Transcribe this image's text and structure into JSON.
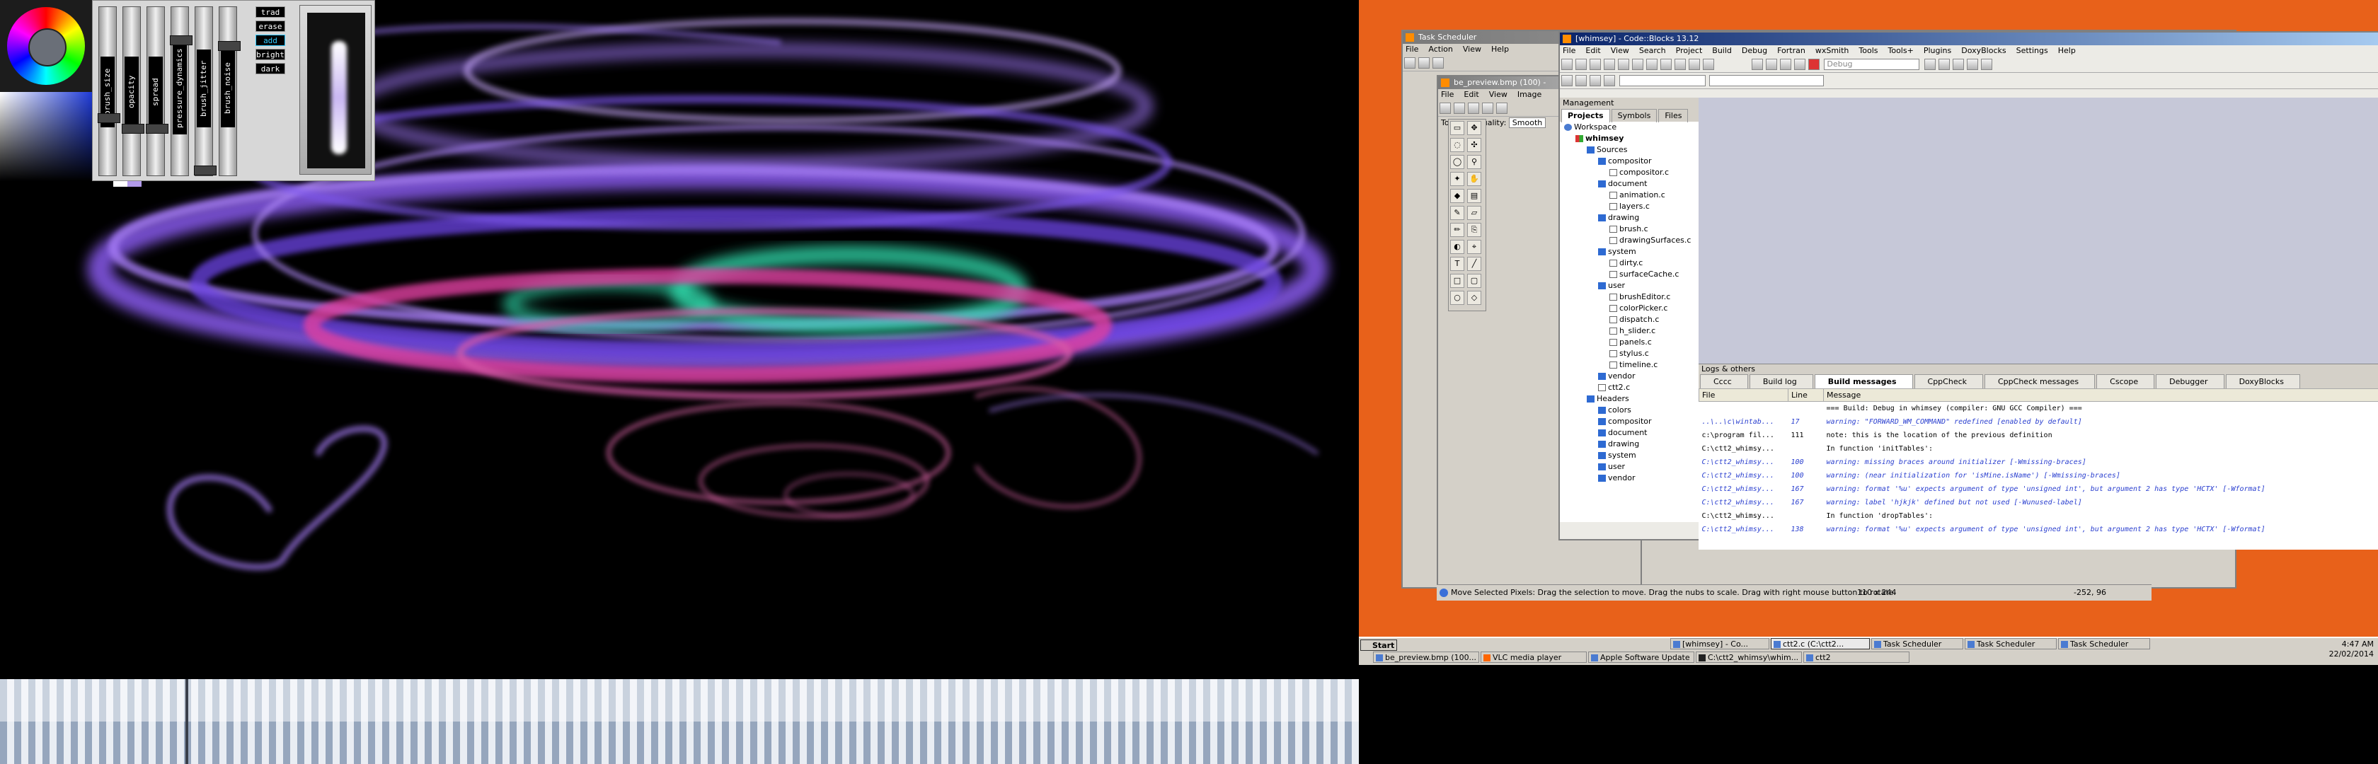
{
  "brush_panel": {
    "sliders": [
      "brush_size",
      "opacity",
      "spread",
      "pressure_dynamics",
      "brush_jitter",
      "brush_noise"
    ],
    "mode_buttons": [
      "trad",
      "erase",
      "add",
      "bright",
      "dark"
    ],
    "active_mode": "add",
    "colors": {
      "accent": "#33ccff",
      "swatch_a": "#ffffff",
      "swatch_b": "#b29bea"
    }
  },
  "colors": {
    "desktop_bg": "#e8611a",
    "stroke_violet": "#8a5cf0",
    "stroke_pink": "#e040a0",
    "stroke_teal": "#30e0b0"
  },
  "task_scheduler": {
    "title": "Task Scheduler",
    "menu": [
      "File",
      "Action",
      "View",
      "Help"
    ]
  },
  "paint": {
    "tab_title": "be_preview.bmp (100) -",
    "menu": [
      "File",
      "Edit",
      "View",
      "Image"
    ],
    "tool_label": "Tool:",
    "quality_label": "Quality:",
    "quality_value": "Smooth",
    "status_text": "Move Selected Pixels: Drag the selection to move. Drag the nubs to scale. Drag with right mouse button to rotate.",
    "selection_size": "110 x 244",
    "cursor_pos": "-252, 96"
  },
  "codeblocks": {
    "title": "[whimsey] - Code::Blocks 13.12",
    "menu": [
      "File",
      "Edit",
      "View",
      "Search",
      "Project",
      "Build",
      "Debug",
      "Fortran",
      "wxSmith",
      "Tools",
      "Tools+",
      "Plugins",
      "DoxyBlocks",
      "Settings",
      "Help"
    ],
    "build_target": "Debug",
    "management": {
      "header": "Management",
      "tabs": [
        "Projects",
        "Symbols",
        "Files"
      ],
      "tree": [
        {
          "depth": 0,
          "type": "ws",
          "label": "Workspace"
        },
        {
          "depth": 1,
          "type": "proj",
          "label": "whimsey"
        },
        {
          "depth": 2,
          "type": "folder",
          "label": "Sources"
        },
        {
          "depth": 3,
          "type": "folder",
          "label": "compositor"
        },
        {
          "depth": 4,
          "type": "file",
          "label": "compositor.c"
        },
        {
          "depth": 3,
          "type": "folder",
          "label": "document"
        },
        {
          "depth": 4,
          "type": "file",
          "label": "animation.c"
        },
        {
          "depth": 4,
          "type": "file",
          "label": "layers.c"
        },
        {
          "depth": 3,
          "type": "folder",
          "label": "drawing"
        },
        {
          "depth": 4,
          "type": "file",
          "label": "brush.c"
        },
        {
          "depth": 4,
          "type": "file",
          "label": "drawingSurfaces.c"
        },
        {
          "depth": 3,
          "type": "folder",
          "label": "system"
        },
        {
          "depth": 4,
          "type": "file",
          "label": "dirty.c"
        },
        {
          "depth": 4,
          "type": "file",
          "label": "surfaceCache.c"
        },
        {
          "depth": 3,
          "type": "folder",
          "label": "user"
        },
        {
          "depth": 4,
          "type": "file",
          "label": "brushEditor.c"
        },
        {
          "depth": 4,
          "type": "file",
          "label": "colorPicker.c"
        },
        {
          "depth": 4,
          "type": "file",
          "label": "dispatch.c"
        },
        {
          "depth": 4,
          "type": "file",
          "label": "h_slider.c"
        },
        {
          "depth": 4,
          "type": "file",
          "label": "panels.c"
        },
        {
          "depth": 4,
          "type": "file",
          "label": "stylus.c"
        },
        {
          "depth": 4,
          "type": "file",
          "label": "timeline.c"
        },
        {
          "depth": 3,
          "type": "folder",
          "label": "vendor"
        },
        {
          "depth": 3,
          "type": "file",
          "label": "ctt2.c"
        },
        {
          "depth": 2,
          "type": "folder",
          "label": "Headers"
        },
        {
          "depth": 3,
          "type": "folder",
          "label": "colors"
        },
        {
          "depth": 3,
          "type": "folder",
          "label": "compositor"
        },
        {
          "depth": 3,
          "type": "folder",
          "label": "document"
        },
        {
          "depth": 3,
          "type": "folder",
          "label": "drawing"
        },
        {
          "depth": 3,
          "type": "folder",
          "label": "system"
        },
        {
          "depth": 3,
          "type": "folder",
          "label": "user"
        },
        {
          "depth": 3,
          "type": "folder",
          "label": "vendor"
        }
      ]
    },
    "logs": {
      "header": "Logs & others",
      "tabs": [
        "Cccc",
        "Build log",
        "Build messages",
        "CppCheck",
        "CppCheck messages",
        "Cscope",
        "Debugger",
        "DoxyBlocks"
      ],
      "active_tab": "Build messages",
      "columns": [
        "File",
        "Line",
        "Message"
      ],
      "rows": [
        {
          "file": "",
          "line": "",
          "message": "=== Build: Debug in whimsey (compiler: GNU GCC Compiler) ===",
          "kind": "info"
        },
        {
          "file": "..\\..\\c\\wintab...",
          "line": "17",
          "message": "warning: \"FORWARD_WM_COMMAND\" redefined [enabled by default]",
          "kind": "warn"
        },
        {
          "file": "c:\\program fil...",
          "line": "111",
          "message": "note: this is the location of the previous definition",
          "kind": "info"
        },
        {
          "file": "C:\\ctt2_whimsy...",
          "line": "",
          "message": "In function 'initTables':",
          "kind": "info"
        },
        {
          "file": "C:\\ctt2_whimsy...",
          "line": "100",
          "message": "warning: missing braces around initializer [-Wmissing-braces]",
          "kind": "warn"
        },
        {
          "file": "C:\\ctt2_whimsy...",
          "line": "100",
          "message": "warning: (near initialization for 'isMine.isName') [-Wmissing-braces]",
          "kind": "warn"
        },
        {
          "file": "C:\\ctt2_whimsy...",
          "line": "167",
          "message": "warning: format '%u' expects argument of type 'unsigned int', but argument 2 has type 'HCTX' [-Wformat]",
          "kind": "warn"
        },
        {
          "file": "C:\\ctt2_whimsy...",
          "line": "167",
          "message": "warning: label 'hjkjk' defined but not used [-Wunused-label]",
          "kind": "warn"
        },
        {
          "file": "C:\\ctt2_whimsy...",
          "line": "",
          "message": "In function 'dropTables':",
          "kind": "info"
        },
        {
          "file": "C:\\ctt2_whimsy...",
          "line": "138",
          "message": "warning: format '%u' expects argument of type 'unsigned int', but argument 2 has type 'HCTX' [-Wformat]",
          "kind": "warn"
        }
      ]
    }
  },
  "taskbar": {
    "start_label": "Start",
    "row1": [
      "[whimsey] - Co...",
      "ctt2.c (C:\\ctt2...",
      "Task Scheduler",
      "Task Scheduler",
      "Task Scheduler"
    ],
    "row2": [
      "be_preview.bmp (100...",
      "VLC media player",
      "Apple Software Update",
      "C:\\ctt2_whimsy\\whim...",
      "ctt2"
    ],
    "clock_time": "4:47 AM",
    "clock_date": "22/02/2014"
  }
}
